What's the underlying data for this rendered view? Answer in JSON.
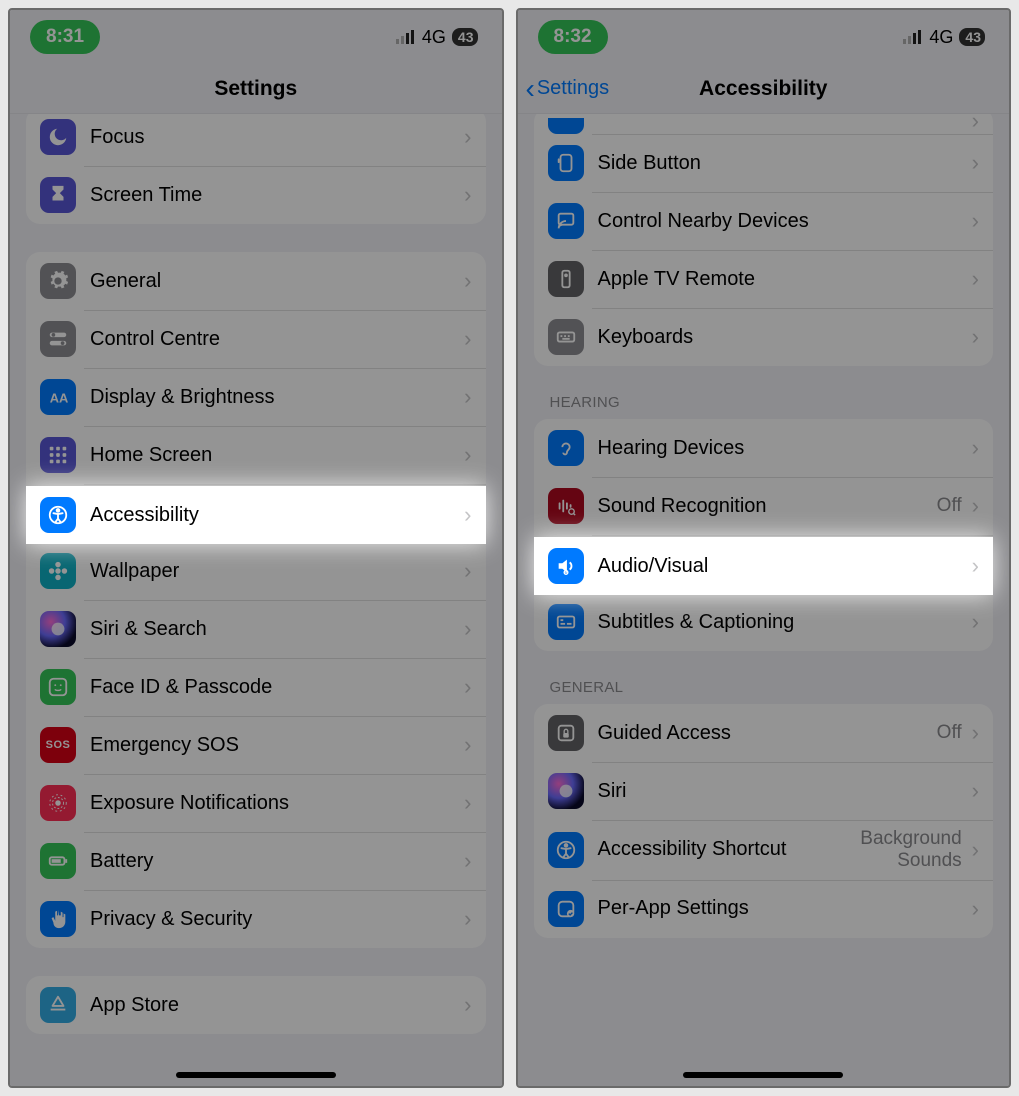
{
  "left": {
    "status": {
      "time": "8:31",
      "network": "4G",
      "battery": "43"
    },
    "nav": {
      "title": "Settings"
    },
    "scrollTop": -6,
    "groups": [
      {
        "rows": [
          {
            "id": "focus",
            "label": "Focus",
            "iconColor": "c-indigo",
            "icon": "moon"
          },
          {
            "id": "screen-time",
            "label": "Screen Time",
            "iconColor": "c-indigo",
            "icon": "hourglass"
          }
        ]
      },
      {
        "rows": [
          {
            "id": "general",
            "label": "General",
            "iconColor": "c-grey",
            "icon": "gear"
          },
          {
            "id": "control-centre",
            "label": "Control Centre",
            "iconColor": "c-grey",
            "icon": "switches"
          },
          {
            "id": "display-brightness",
            "label": "Display & Brightness",
            "iconColor": "c-blue",
            "icon": "aa"
          },
          {
            "id": "home-screen",
            "label": "Home Screen",
            "iconColor": "c-indigo",
            "icon": "grid"
          },
          {
            "id": "accessibility",
            "label": "Accessibility",
            "iconColor": "c-blue",
            "icon": "access",
            "highlight": true
          },
          {
            "id": "wallpaper",
            "label": "Wallpaper",
            "iconColor": "c-cyan",
            "icon": "flower"
          },
          {
            "id": "siri-search",
            "label": "Siri & Search",
            "iconColor": "c-siri",
            "icon": "siri"
          },
          {
            "id": "face-id",
            "label": "Face ID & Passcode",
            "iconColor": "c-green",
            "icon": "face"
          },
          {
            "id": "emergency-sos",
            "label": "Emergency SOS",
            "iconColor": "c-sosred",
            "icon": "sos"
          },
          {
            "id": "exposure",
            "label": "Exposure Notifications",
            "iconColor": "c-pinkred",
            "icon": "exposure"
          },
          {
            "id": "battery",
            "label": "Battery",
            "iconColor": "c-green",
            "icon": "battery"
          },
          {
            "id": "privacy-security",
            "label": "Privacy & Security",
            "iconColor": "c-blue",
            "icon": "hand"
          }
        ]
      },
      {
        "rows": [
          {
            "id": "app-store",
            "label": "App Store",
            "iconColor": "c-lightblue",
            "icon": "appstore"
          }
        ]
      }
    ]
  },
  "right": {
    "status": {
      "time": "8:32",
      "network": "4G",
      "battery": "43"
    },
    "nav": {
      "title": "Accessibility",
      "back": "Settings"
    },
    "scrollTop": -6,
    "groups": [
      {
        "rows": [
          {
            "id": "top-hidden",
            "label": "",
            "iconColor": "c-blue",
            "icon": "blank",
            "partial": true
          },
          {
            "id": "side-button",
            "label": "Side Button",
            "iconColor": "c-blue",
            "icon": "sidebtn"
          },
          {
            "id": "control-nearby",
            "label": "Control Nearby Devices",
            "iconColor": "c-blue",
            "icon": "cast"
          },
          {
            "id": "atv-remote",
            "label": "Apple TV Remote",
            "iconColor": "c-darkgrey",
            "icon": "remote"
          },
          {
            "id": "keyboards",
            "label": "Keyboards",
            "iconColor": "c-grey",
            "icon": "keyboard"
          }
        ]
      },
      {
        "header": "HEARING",
        "rows": [
          {
            "id": "hearing-devices",
            "label": "Hearing Devices",
            "iconColor": "c-blue",
            "icon": "ear"
          },
          {
            "id": "sound-recognition",
            "label": "Sound Recognition",
            "iconColor": "c-darkred",
            "icon": "soundrec",
            "value": "Off"
          },
          {
            "id": "audio-visual",
            "label": "Audio/Visual",
            "iconColor": "c-blue",
            "icon": "audiovisual",
            "highlight": true
          },
          {
            "id": "subtitles",
            "label": "Subtitles & Captioning",
            "iconColor": "c-blue",
            "icon": "cc"
          }
        ]
      },
      {
        "header": "GENERAL",
        "rows": [
          {
            "id": "guided-access",
            "label": "Guided Access",
            "iconColor": "c-darkgrey",
            "icon": "lock",
            "value": "Off"
          },
          {
            "id": "siri",
            "label": "Siri",
            "iconColor": "c-siri",
            "icon": "siri"
          },
          {
            "id": "accessibility-shortcut",
            "label": "Accessibility Shortcut",
            "iconColor": "c-blue",
            "icon": "access",
            "value": "Background\nSounds"
          },
          {
            "id": "per-app",
            "label": "Per-App Settings",
            "iconColor": "c-blue",
            "icon": "perapp"
          }
        ]
      }
    ]
  }
}
